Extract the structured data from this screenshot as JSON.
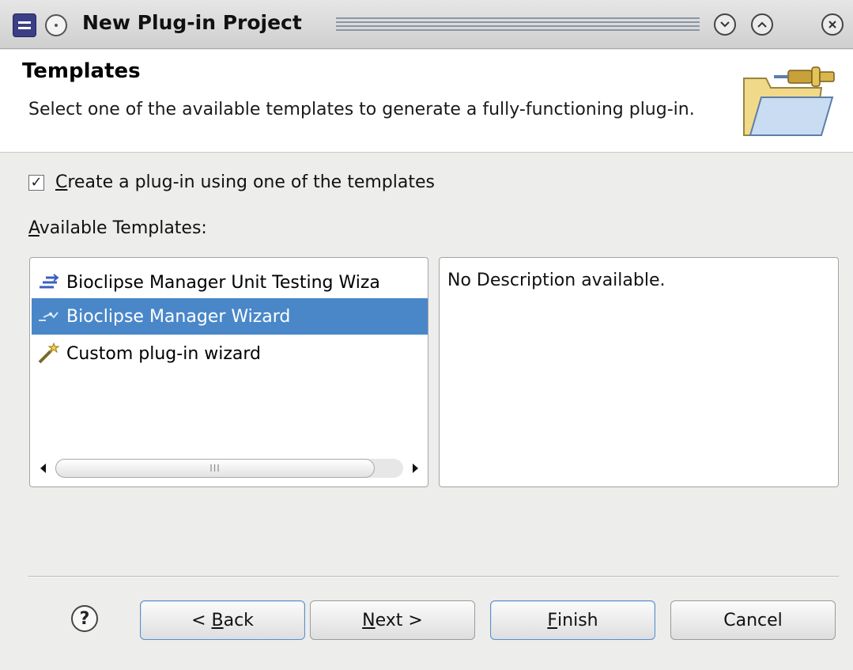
{
  "window": {
    "title": "New Plug-in Project"
  },
  "banner": {
    "title": "Templates",
    "description": "Select one of the available templates to generate a fully-functioning plug-in."
  },
  "checkbox": {
    "checked": true,
    "mnemonic": "C",
    "label_rest": "reate a plug-in using one of the templates"
  },
  "templates_label": {
    "mnemonic": "A",
    "rest": "vailable Templates:"
  },
  "templates": [
    {
      "label": "Bioclipse Manager Unit Testing Wiza",
      "icon": "unit-test-wizard-icon",
      "selected": false
    },
    {
      "label": "Bioclipse Manager Wizard",
      "icon": "manager-wizard-icon",
      "selected": true
    },
    {
      "label": "Custom plug-in wizard",
      "icon": "custom-wizard-icon",
      "selected": false
    }
  ],
  "scrollbar": {
    "grip": "III"
  },
  "description_panel": {
    "text": "No Description available."
  },
  "buttons": {
    "back": {
      "prefix": "< ",
      "mnemonic": "B",
      "rest": "ack"
    },
    "next": {
      "mnemonic": "N",
      "rest": "ext >"
    },
    "finish": {
      "mnemonic": "F",
      "rest": "inish"
    },
    "cancel": "Cancel"
  },
  "colors": {
    "selection": "#4a87c9",
    "title_stripes": "#8a96a6"
  }
}
